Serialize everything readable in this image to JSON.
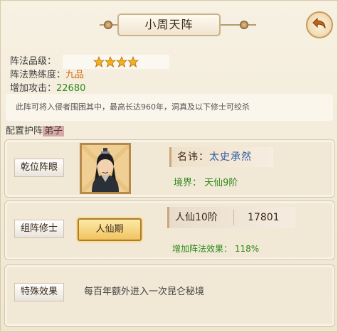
{
  "title": "小周天阵",
  "info": {
    "grade_label": "阵法品级：",
    "grade_stars": 4,
    "proficiency_label": "阵法熟练度：",
    "proficiency_value": "九品",
    "attack_label": "增加攻击：",
    "attack_value": "22680"
  },
  "description": "此阵可将入侵者围困其中，最高长达960年，洞真及以下修士可绞杀",
  "section": {
    "label_prefix": "配置护阵",
    "label_highlight": "弟子"
  },
  "eye": {
    "tag": "乾位阵眼",
    "name_label": "名讳：",
    "name_value": "太史承然",
    "realm": "境界：  天仙9阶"
  },
  "member": {
    "tag": "组阵修士",
    "stage_button": "人仙期",
    "level": "人仙10阶",
    "power": "17801",
    "bonus": "增加阵法效果：  118%"
  },
  "special": {
    "tag": "特殊效果",
    "text": "每百年额外进入一次昆仑秘境"
  },
  "colors": {
    "accent_orange": "#d4640a",
    "accent_green": "#2f8a1c",
    "name_blue": "#2a5aa0",
    "star_gold": "#f3b21b"
  }
}
